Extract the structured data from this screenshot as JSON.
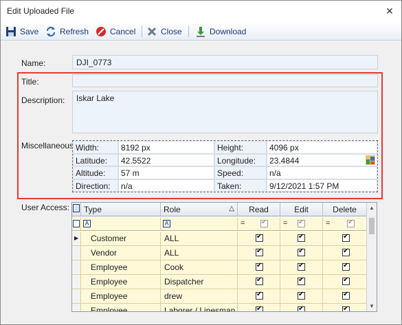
{
  "window": {
    "title": "Edit Uploaded File",
    "close_glyph": "✕"
  },
  "toolbar": {
    "save_label": "Save",
    "refresh_label": "Refresh",
    "cancel_label": "Cancel",
    "close_label": "Close",
    "download_label": "Download"
  },
  "form": {
    "name_label": "Name:",
    "name_value": "DJI_0773",
    "title_label": "Title:",
    "title_value": "",
    "description_label": "Description:",
    "description_value": "Iskar Lake",
    "misc_label": "Miscellaneous:",
    "user_access_label": "User Access:"
  },
  "misc": {
    "width_label": "Width:",
    "width_value": "8192 px",
    "height_label": "Height:",
    "height_value": "4096 px",
    "latitude_label": "Latitude:",
    "latitude_value": "42.5522",
    "longitude_label": "Longitude:",
    "longitude_value": "23.4844",
    "altitude_label": "Altitude:",
    "altitude_value": "57 m",
    "speed_label": "Speed:",
    "speed_value": "n/a",
    "direction_label": "Direction:",
    "direction_value": "n/a",
    "taken_label": "Taken:",
    "taken_value": "9/12/2021 1:57 PM"
  },
  "access_grid": {
    "columns": {
      "type": "Type",
      "role": "Role",
      "read": "Read",
      "edit": "Edit",
      "delete": "Delete"
    },
    "filter_eq": "=",
    "filter_a": "A",
    "rows": [
      {
        "type": "Customer",
        "role": "ALL",
        "read": true,
        "edit": true,
        "delete": true
      },
      {
        "type": "Vendor",
        "role": "ALL",
        "read": true,
        "edit": true,
        "delete": true
      },
      {
        "type": "Employee",
        "role": "Cook",
        "read": true,
        "edit": true,
        "delete": true
      },
      {
        "type": "Employee",
        "role": "Dispatcher",
        "read": true,
        "edit": true,
        "delete": true
      },
      {
        "type": "Employee",
        "role": "drew",
        "read": true,
        "edit": true,
        "delete": true
      },
      {
        "type": "Employee",
        "role": "Laborer / Linesman",
        "read": true,
        "edit": true,
        "delete": true
      }
    ]
  },
  "colors": {
    "highlight": "#e53935",
    "field_bg": "#edf3fa",
    "grid_row_bg": "#fff9d9",
    "toolbar_text": "#1d3a7a"
  }
}
